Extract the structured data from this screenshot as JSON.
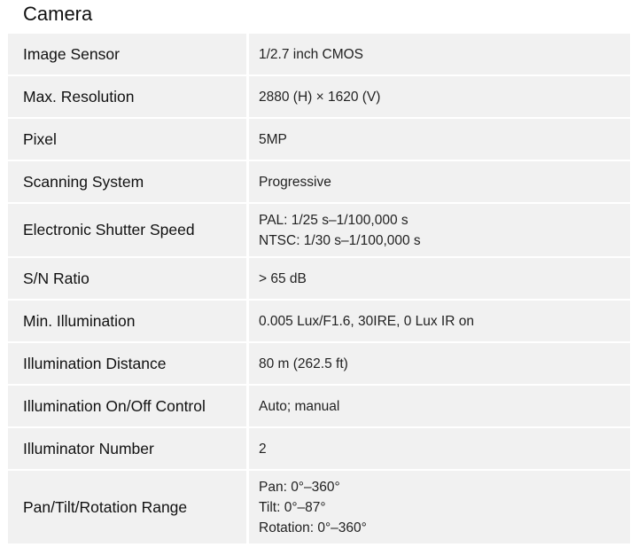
{
  "section": {
    "title": "Camera"
  },
  "specs": [
    {
      "label": "Image Sensor",
      "lines": [
        "1/2.7 inch CMOS"
      ]
    },
    {
      "label": "Max. Resolution",
      "lines": [
        "2880 (H) × 1620 (V)"
      ]
    },
    {
      "label": "Pixel",
      "lines": [
        "5MP"
      ]
    },
    {
      "label": "Scanning System",
      "lines": [
        "Progressive"
      ]
    },
    {
      "label": "Electronic Shutter Speed",
      "lines": [
        "PAL: 1/25 s–1/100,000 s",
        "NTSC: 1/30 s–1/100,000 s"
      ]
    },
    {
      "label": "S/N Ratio",
      "lines": [
        "> 65 dB"
      ]
    },
    {
      "label": "Min. Illumination",
      "lines": [
        "0.005 Lux/F1.6, 30IRE, 0 Lux IR on"
      ]
    },
    {
      "label": "Illumination Distance",
      "lines": [
        "80 m (262.5 ft)"
      ]
    },
    {
      "label": "Illumination On/Off Control",
      "lines": [
        "Auto; manual"
      ]
    },
    {
      "label": "Illuminator Number",
      "lines": [
        "2"
      ]
    },
    {
      "label": "Pan/Tilt/Rotation Range",
      "lines": [
        "Pan: 0°–360°",
        "Tilt: 0°–87°",
        "Rotation: 0°–360°"
      ]
    }
  ]
}
